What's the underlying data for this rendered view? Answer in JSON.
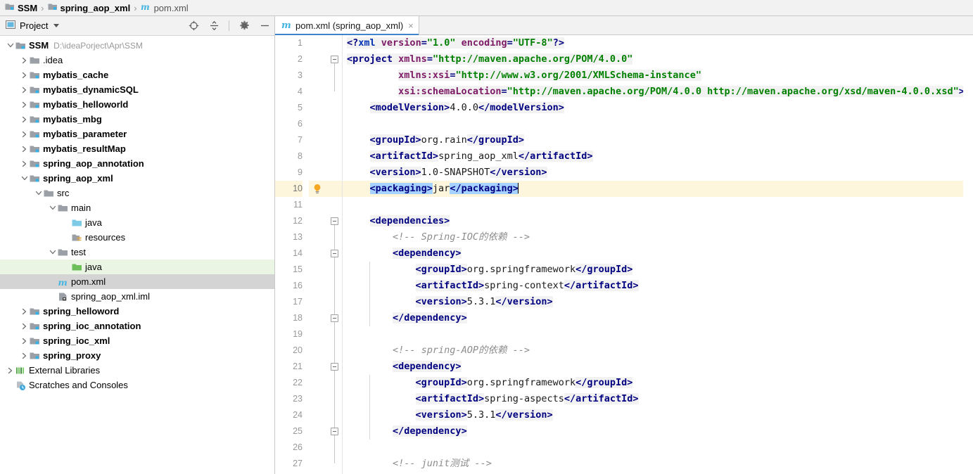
{
  "breadcrumb": {
    "items": [
      {
        "label": "SSM",
        "icon": "module-icon",
        "bold": true
      },
      {
        "label": "spring_aop_xml",
        "icon": "module-icon",
        "bold": true
      },
      {
        "label": "pom.xml",
        "icon": "maven-icon",
        "bold": false
      }
    ],
    "separator": "›"
  },
  "project_panel": {
    "title": "Project",
    "dropdown_icon": "chevron-down-icon",
    "toolbar": [
      {
        "name": "select-opened-file-icon",
        "title": "Select Opened File"
      },
      {
        "name": "collapse-all-icon",
        "title": "Collapse All"
      },
      {
        "name": "gear-icon",
        "title": "Settings"
      },
      {
        "name": "hide-icon",
        "title": "Hide"
      }
    ],
    "tree": [
      {
        "label": "SSM",
        "path": "D:\\ideaPorject\\Apr\\SSM",
        "indent": 0,
        "twist": "down",
        "icon": "module-icon",
        "bold": true,
        "state": "none"
      },
      {
        "label": ".idea",
        "path": "",
        "indent": 1,
        "twist": "right",
        "icon": "folder-icon",
        "bold": false,
        "state": "none"
      },
      {
        "label": "mybatis_cache",
        "path": "",
        "indent": 1,
        "twist": "right",
        "icon": "module-icon",
        "bold": true,
        "state": "none"
      },
      {
        "label": "mybatis_dynamicSQL",
        "path": "",
        "indent": 1,
        "twist": "right",
        "icon": "module-icon",
        "bold": true,
        "state": "none"
      },
      {
        "label": "mybatis_helloworld",
        "path": "",
        "indent": 1,
        "twist": "right",
        "icon": "module-icon",
        "bold": true,
        "state": "none"
      },
      {
        "label": "mybatis_mbg",
        "path": "",
        "indent": 1,
        "twist": "right",
        "icon": "module-icon",
        "bold": true,
        "state": "none"
      },
      {
        "label": "mybatis_parameter",
        "path": "",
        "indent": 1,
        "twist": "right",
        "icon": "module-icon",
        "bold": true,
        "state": "none"
      },
      {
        "label": "mybatis_resultMap",
        "path": "",
        "indent": 1,
        "twist": "right",
        "icon": "module-icon",
        "bold": true,
        "state": "none"
      },
      {
        "label": "spring_aop_annotation",
        "path": "",
        "indent": 1,
        "twist": "right",
        "icon": "module-icon",
        "bold": true,
        "state": "none"
      },
      {
        "label": "spring_aop_xml",
        "path": "",
        "indent": 1,
        "twist": "down",
        "icon": "module-icon",
        "bold": true,
        "state": "none"
      },
      {
        "label": "src",
        "path": "",
        "indent": 2,
        "twist": "down",
        "icon": "folder-icon",
        "bold": false,
        "state": "none"
      },
      {
        "label": "main",
        "path": "",
        "indent": 3,
        "twist": "down",
        "icon": "folder-icon",
        "bold": false,
        "state": "none"
      },
      {
        "label": "java",
        "path": "",
        "indent": 4,
        "twist": "none",
        "icon": "source-folder-icon",
        "bold": false,
        "state": "none"
      },
      {
        "label": "resources",
        "path": "",
        "indent": 4,
        "twist": "none",
        "icon": "resources-folder-icon",
        "bold": false,
        "state": "none"
      },
      {
        "label": "test",
        "path": "",
        "indent": 3,
        "twist": "down",
        "icon": "folder-icon",
        "bold": false,
        "state": "none"
      },
      {
        "label": "java",
        "path": "",
        "indent": 4,
        "twist": "none",
        "icon": "test-source-folder-icon",
        "bold": false,
        "state": "green"
      },
      {
        "label": "pom.xml",
        "path": "",
        "indent": 3,
        "twist": "none",
        "icon": "maven-icon",
        "bold": false,
        "state": "selected"
      },
      {
        "label": "spring_aop_xml.iml",
        "path": "",
        "indent": 3,
        "twist": "none",
        "icon": "iml-icon",
        "bold": false,
        "state": "none"
      },
      {
        "label": "spring_helloword",
        "path": "",
        "indent": 1,
        "twist": "right",
        "icon": "module-icon",
        "bold": true,
        "state": "none"
      },
      {
        "label": "spring_ioc_annotation",
        "path": "",
        "indent": 1,
        "twist": "right",
        "icon": "module-icon",
        "bold": true,
        "state": "none"
      },
      {
        "label": "spring_ioc_xml",
        "path": "",
        "indent": 1,
        "twist": "right",
        "icon": "module-icon",
        "bold": true,
        "state": "none"
      },
      {
        "label": "spring_proxy",
        "path": "",
        "indent": 1,
        "twist": "right",
        "icon": "module-icon",
        "bold": true,
        "state": "none"
      },
      {
        "label": "External Libraries",
        "path": "",
        "indent": 0,
        "twist": "right",
        "icon": "libraries-icon",
        "bold": false,
        "state": "none"
      },
      {
        "label": "Scratches and Consoles",
        "path": "",
        "indent": 0,
        "twist": "none",
        "icon": "scratches-icon",
        "bold": false,
        "state": "none"
      }
    ]
  },
  "editor": {
    "tab": {
      "label": "pom.xml (spring_aop_xml)",
      "icon": "maven-icon",
      "close_label": "×"
    },
    "current_line": 10,
    "intention_icon": "lightbulb-icon",
    "line_numbers": [
      "1",
      "2",
      "3",
      "4",
      "5",
      "6",
      "7",
      "8",
      "9",
      "10",
      "11",
      "12",
      "13",
      "14",
      "15",
      "16",
      "17",
      "18",
      "19",
      "20",
      "21",
      "22",
      "23",
      "24",
      "25",
      "26",
      "27"
    ],
    "lines": [
      {
        "n": 1,
        "text": "<?xml version=\"1.0\" encoding=\"UTF-8\"?>"
      },
      {
        "n": 2,
        "text": "<project xmlns=\"http://maven.apache.org/POM/4.0.0\""
      },
      {
        "n": 3,
        "text": "         xmlns:xsi=\"http://www.w3.org/2001/XMLSchema-instance\""
      },
      {
        "n": 4,
        "text": "         xsi:schemaLocation=\"http://maven.apache.org/POM/4.0.0 http://maven.apache.org/xsd/maven-4.0.0.xsd\">"
      },
      {
        "n": 5,
        "text": "    <modelVersion>4.0.0</modelVersion>"
      },
      {
        "n": 6,
        "text": ""
      },
      {
        "n": 7,
        "text": "    <groupId>org.rain</groupId>"
      },
      {
        "n": 8,
        "text": "    <artifactId>spring_aop_xml</artifactId>"
      },
      {
        "n": 9,
        "text": "    <version>1.0-SNAPSHOT</version>"
      },
      {
        "n": 10,
        "text": "    <packaging>jar</packaging>"
      },
      {
        "n": 11,
        "text": ""
      },
      {
        "n": 12,
        "text": "    <dependencies>"
      },
      {
        "n": 13,
        "text": "        <!-- Spring-IOC的依赖 -->"
      },
      {
        "n": 14,
        "text": "        <dependency>"
      },
      {
        "n": 15,
        "text": "            <groupId>org.springframework</groupId>"
      },
      {
        "n": 16,
        "text": "            <artifactId>spring-context</artifactId>"
      },
      {
        "n": 17,
        "text": "            <version>5.3.1</version>"
      },
      {
        "n": 18,
        "text": "        </dependency>"
      },
      {
        "n": 19,
        "text": ""
      },
      {
        "n": 20,
        "text": "        <!-- spring-AOP的依赖 -->"
      },
      {
        "n": 21,
        "text": "        <dependency>"
      },
      {
        "n": 22,
        "text": "            <groupId>org.springframework</groupId>"
      },
      {
        "n": 23,
        "text": "            <artifactId>spring-aspects</artifactId>"
      },
      {
        "n": 24,
        "text": "            <version>5.3.1</version>"
      },
      {
        "n": 25,
        "text": "        </dependency>"
      },
      {
        "n": 26,
        "text": ""
      },
      {
        "n": 27,
        "text": "        <!-- junit测试 -->"
      }
    ],
    "fold_markers": [
      2,
      12,
      14,
      18,
      21,
      25
    ]
  },
  "colors": {
    "tag": "#000080",
    "attribute": "#7d1a66",
    "string": "#008000",
    "comment": "#8c8c8c",
    "selection": "#a6d2ff",
    "current_line_bg": "#fdf6dd",
    "tree_selection_bg": "#d4d4d4",
    "test_source_bg": "#eaf5e4",
    "tab_underline": "#4083c9"
  }
}
